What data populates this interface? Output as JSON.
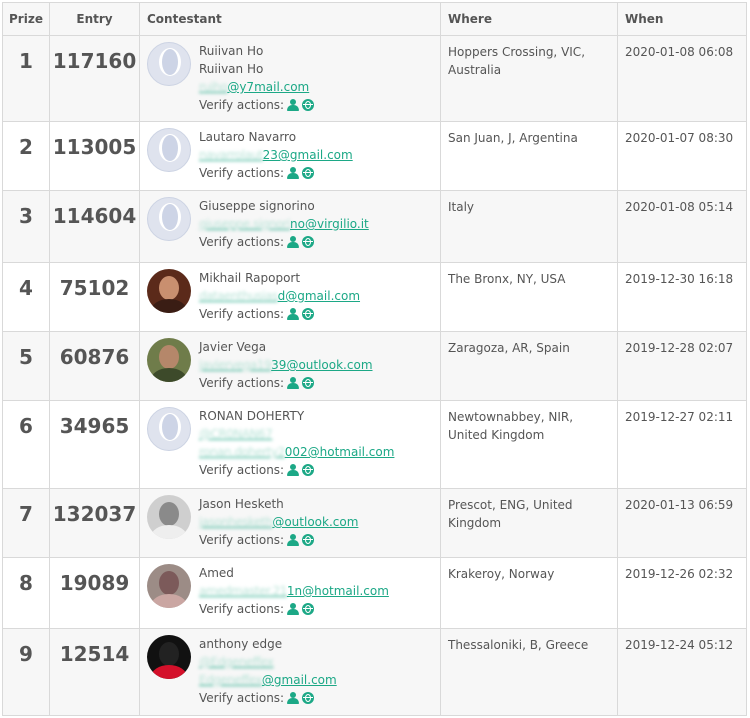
{
  "headers": {
    "prize": "Prize",
    "entry": "Entry",
    "contestant": "Contestant",
    "where": "Where",
    "when": "When"
  },
  "verify_label": "Verify actions:",
  "rows": [
    {
      "prize": "1",
      "entry": "117160",
      "name": "Ruiivan Ho",
      "name2": "Ruiivan Ho",
      "handle": "",
      "email_blur": "ruiho",
      "email_visible": "@y7mail.com",
      "where": "Hoppers Crossing, VIC, Australia",
      "when": "2020-01-08 06:08",
      "avatar": "default"
    },
    {
      "prize": "2",
      "entry": "113005",
      "name": "Lautaro Navarro",
      "name2": "",
      "handle": "",
      "email_blur": "navarrolaut",
      "email_visible": "23@gmail.com",
      "where": "San Juan, J, Argentina",
      "when": "2020-01-07 08:30",
      "avatar": "default"
    },
    {
      "prize": "3",
      "entry": "114604",
      "name": "Giuseppe signorino",
      "name2": "",
      "handle": "",
      "email_blur": "giuseppe.signori",
      "email_visible": "no@virgilio.it",
      "where": "Italy",
      "when": "2020-01-08 05:14",
      "avatar": "default"
    },
    {
      "prize": "4",
      "entry": "75102",
      "name": "Mikhail Rapoport",
      "name2": "",
      "handle": "",
      "email_blur": "dataenthusias",
      "email_visible": "d@gmail.com",
      "where": "The Bronx, NY, USA",
      "when": "2019-12-30 16:18",
      "avatar": "photo-beard"
    },
    {
      "prize": "5",
      "entry": "60876",
      "name": "Javier Vega",
      "name2": "",
      "handle": "",
      "email_blur": "javiervega19",
      "email_visible": "39@outlook.com",
      "where": "Zaragoza, AR, Spain",
      "when": "2019-12-28 02:07",
      "avatar": "photo-outdoor"
    },
    {
      "prize": "6",
      "entry": "34965",
      "name": "RONAN DOHERTY",
      "name2": "",
      "handle_blur": "@CR0NAN67",
      "email_blur": "ronan.doherty2",
      "email_visible": "002@hotmail.com",
      "where": "Newtownabbey, NIR, United Kingdom",
      "when": "2019-12-27 02:11",
      "avatar": "default"
    },
    {
      "prize": "7",
      "entry": "132037",
      "name": "Jason Hesketh",
      "name2": "",
      "handle": "",
      "email_blur": "jasonhesketh",
      "email_visible": "@outlook.com",
      "where": "Prescot, ENG, United Kingdom",
      "when": "2020-01-13 06:59",
      "avatar": "photo-grey"
    },
    {
      "prize": "8",
      "entry": "19089",
      "name": "Amed",
      "name2": "",
      "handle": "",
      "email_blur": "amedmaster.21",
      "email_visible": "1n@hotmail.com",
      "where": "Krakeroy, Norway",
      "when": "2019-12-26 02:32",
      "avatar": "photo-face"
    },
    {
      "prize": "9",
      "entry": "12514",
      "name": "anthony edge",
      "name2": "",
      "handle_blur": "@Edgeneffex",
      "email_blur": "Edgeneffex",
      "email_visible": "@gmail.com",
      "where": "Thessaloniki, B, Greece",
      "when": "2019-12-24 05:12",
      "avatar": "photo-red"
    }
  ],
  "colors": {
    "accent": "#1ca886",
    "border": "#d9d9d9",
    "row_alt": "#f7f7f7",
    "avatar_default": "#dfe3ee"
  }
}
